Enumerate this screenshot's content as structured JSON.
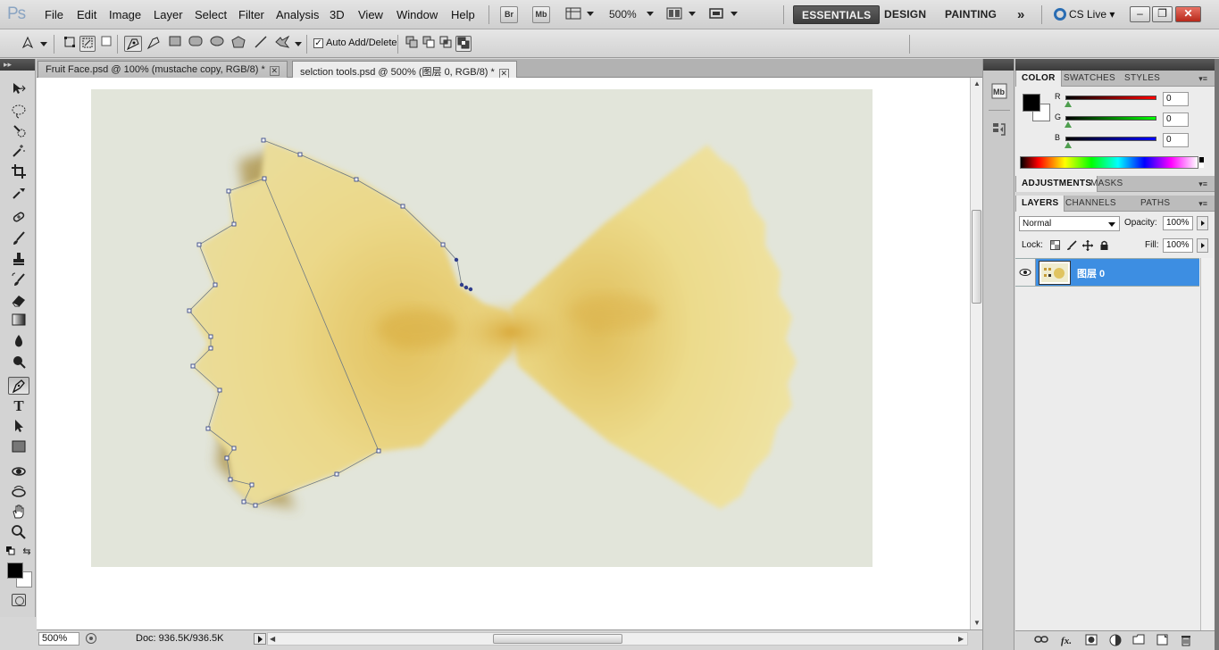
{
  "app": {
    "logo": "Ps",
    "menus": [
      "File",
      "Edit",
      "Image",
      "Layer",
      "Select",
      "Filter",
      "Analysis",
      "3D",
      "View",
      "Window",
      "Help"
    ],
    "bridge_label": "Br",
    "minibridge_label": "Mb",
    "zoom_menu": "500%",
    "workspaces": {
      "essentials": "ESSENTIALS",
      "design": "DESIGN",
      "painting": "PAINTING",
      "more": "»"
    },
    "cs_live": "CS Live",
    "window_controls": {
      "minimize": "–",
      "restore": "❐",
      "close": "✕"
    }
  },
  "options_bar": {
    "auto_add_delete_label": "Auto Add/Delete",
    "auto_add_checked": "✓"
  },
  "toolbar": {
    "icons": [
      "move-icon",
      "lasso-icon",
      "quick-selection-icon",
      "crop-icon",
      "eyedropper-icon",
      "healing-brush-icon",
      "brush-icon",
      "clone-stamp-icon",
      "history-brush-icon",
      "eraser-icon",
      "gradient-icon",
      "blur-icon",
      "dodge-icon",
      "pen-icon",
      "type-icon",
      "path-selection-icon",
      "rectangle-icon",
      "3d-rotate-icon",
      "3d-orbit-icon",
      "hand-icon",
      "zoom-icon"
    ],
    "active_tool": "pen-icon",
    "foreground_color": "#000000",
    "background_color": "#ffffff"
  },
  "documents": {
    "tabs": [
      {
        "title": "Fruit Face.psd @ 100% (mustache copy, RGB/8) *",
        "active": false
      },
      {
        "title": "selction tools.psd @ 500% (图层 0, RGB/8) *",
        "active": true
      }
    ],
    "close_glyph": "✕"
  },
  "status_bar": {
    "zoom": "500%",
    "doc_info": "Doc: 936.5K/936.5K"
  },
  "panels": {
    "color_group_tabs": [
      "COLOR",
      "SWATCHES",
      "STYLES"
    ],
    "color": {
      "channels": [
        {
          "label": "R",
          "value": "0"
        },
        {
          "label": "G",
          "value": "0"
        },
        {
          "label": "B",
          "value": "0"
        }
      ]
    },
    "adjust_group_tabs": [
      "ADJUSTMENTS",
      "MASKS"
    ],
    "layers_group_tabs": [
      "LAYERS",
      "CHANNELS",
      "PATHS"
    ],
    "layers": {
      "blend_mode": "Normal",
      "opacity_label": "Opacity:",
      "opacity": "100%",
      "lock_label": "Lock:",
      "fill_label": "Fill:",
      "fill": "100%",
      "items": [
        {
          "name": "图层 0",
          "visible": true
        }
      ]
    }
  },
  "colors": {
    "accent_selected": "#3d8ee2",
    "pasta_fill": "#e9d98f",
    "canvas_bg": "#e2e5da"
  }
}
